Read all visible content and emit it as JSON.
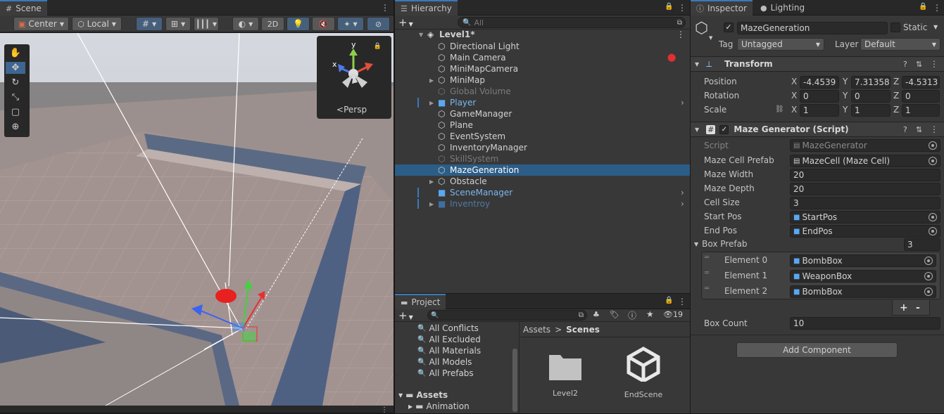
{
  "scene": {
    "tab": "Scene",
    "pivot": "Center",
    "space": "Local",
    "mode_2d": "2D",
    "persp": "Persp",
    "gizmo_axis_y": "y",
    "gizmo_axis_x": "x"
  },
  "hierarchy": {
    "tab": "Hierarchy",
    "search_placeholder": "All",
    "root": "Level1*",
    "items": [
      {
        "label": "Directional Light",
        "style": "normal"
      },
      {
        "label": "Main Camera",
        "style": "normal"
      },
      {
        "label": "MiniMapCamera",
        "style": "normal"
      },
      {
        "label": "MiniMap",
        "style": "normal"
      },
      {
        "label": "Global Volume",
        "style": "disabled"
      },
      {
        "label": "Player",
        "style": "prefab"
      },
      {
        "label": "GameManager",
        "style": "normal"
      },
      {
        "label": "Plane",
        "style": "normal"
      },
      {
        "label": "EventSystem",
        "style": "normal"
      },
      {
        "label": "InventoryManager",
        "style": "normal"
      },
      {
        "label": "SkillSystem",
        "style": "disabled"
      },
      {
        "label": "MazeGeneration",
        "style": "selected"
      },
      {
        "label": "Obstacle",
        "style": "normal"
      },
      {
        "label": "SceneManager",
        "style": "prefab"
      },
      {
        "label": "Inventroy",
        "style": "prefab-disabled"
      }
    ]
  },
  "project": {
    "tab": "Project",
    "count": "19",
    "favorites": [
      "All Conflicts",
      "All Excluded",
      "All Materials",
      "All Models",
      "All Prefabs"
    ],
    "assets_root": "Assets",
    "assets_child": "Animation",
    "breadcrumb": [
      "Assets",
      "Scenes"
    ],
    "grid_items": [
      "Level2",
      "EndScene"
    ]
  },
  "inspector": {
    "tab": "Inspector",
    "lighting_tab": "Lighting",
    "object_name": "MazeGeneration",
    "static_label": "Static",
    "tag_label": "Tag",
    "tag_value": "Untagged",
    "layer_label": "Layer",
    "layer_value": "Default",
    "transform": {
      "title": "Transform",
      "rows": [
        {
          "label": "Position",
          "x": "-4.4539",
          "y": "7.313586",
          "z": "-4.5313"
        },
        {
          "label": "Rotation",
          "x": "0",
          "y": "0",
          "z": "0"
        },
        {
          "label": "Scale",
          "x": "1",
          "y": "1",
          "z": "1"
        }
      ],
      "axis_x": "X",
      "axis_y": "Y",
      "axis_z": "Z"
    },
    "script": {
      "title": "Maze Generator (Script)",
      "script_label": "Script",
      "script_value": "MazeGenerator",
      "fields": [
        {
          "label": "Maze Cell Prefab",
          "value": "MazeCell (Maze Cell)"
        },
        {
          "label": "Maze Width",
          "value": "20"
        },
        {
          "label": "Maze Depth",
          "value": "20"
        },
        {
          "label": "Cell Size",
          "value": "3"
        },
        {
          "label": "Start Pos",
          "value": "StartPos"
        },
        {
          "label": "End Pos",
          "value": "EndPos"
        }
      ],
      "box_prefab_label": "Box Prefab",
      "box_prefab_count": "3",
      "elements": [
        {
          "label": "Element 0",
          "value": "BombBox"
        },
        {
          "label": "Element 1",
          "value": "WeaponBox"
        },
        {
          "label": "Element 2",
          "value": "BombBox"
        }
      ],
      "plus": "+",
      "minus": "-",
      "box_count_label": "Box Count",
      "box_count_value": "10"
    },
    "add_component": "Add Component"
  },
  "colors": {
    "selection": "#2c5d87",
    "prefab_text": "#7bb6f0",
    "active_tab": "#3a79bb"
  }
}
